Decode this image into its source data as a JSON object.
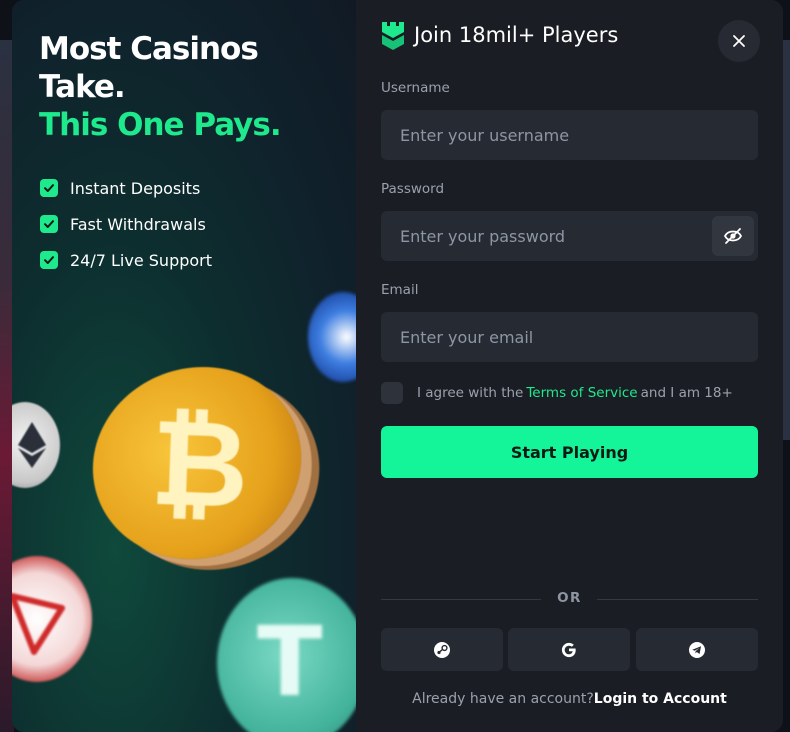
{
  "promo": {
    "headline_line1": "Most Casinos",
    "headline_line2": "Take.",
    "headline_line3": "This One Pays.",
    "features": [
      {
        "label": "Instant Deposits"
      },
      {
        "label": "Fast Withdrawals"
      },
      {
        "label": "24/7 Live Support"
      }
    ],
    "coins": [
      {
        "name": "bitcoin",
        "symbol": "₿"
      },
      {
        "name": "tether",
        "symbol": "T"
      },
      {
        "name": "ethereum"
      },
      {
        "name": "tron"
      },
      {
        "name": "usdc"
      }
    ]
  },
  "signup": {
    "title": "Join 18mil+ Players",
    "logo_icon": "castle-logo-icon",
    "close_icon": "close-icon",
    "username_label": "Username",
    "username_placeholder": "Enter your username",
    "username_value": "",
    "password_label": "Password",
    "password_placeholder": "Enter your password",
    "password_value": "",
    "password_toggle_icon": "eye-off-icon",
    "email_label": "Email",
    "email_placeholder": "Enter your email",
    "email_value": "",
    "agree_prefix": "I agree with the",
    "terms_link": "Terms of Service",
    "agree_suffix": "and I am 18+",
    "agree_checked": false,
    "submit_label": "Start Playing",
    "or_label": "OR",
    "social": [
      {
        "name": "steam",
        "icon": "steam-icon"
      },
      {
        "name": "google",
        "icon": "google-icon"
      },
      {
        "name": "telegram",
        "icon": "telegram-icon"
      }
    ],
    "footer_question": "Already have an account?",
    "footer_login": "Login to Account"
  },
  "colors": {
    "accent": "#14f59a",
    "accent_text": "#1fe98d",
    "panel": "#1a1d24",
    "input_bg": "#262a33",
    "muted": "#9aa1ad"
  }
}
